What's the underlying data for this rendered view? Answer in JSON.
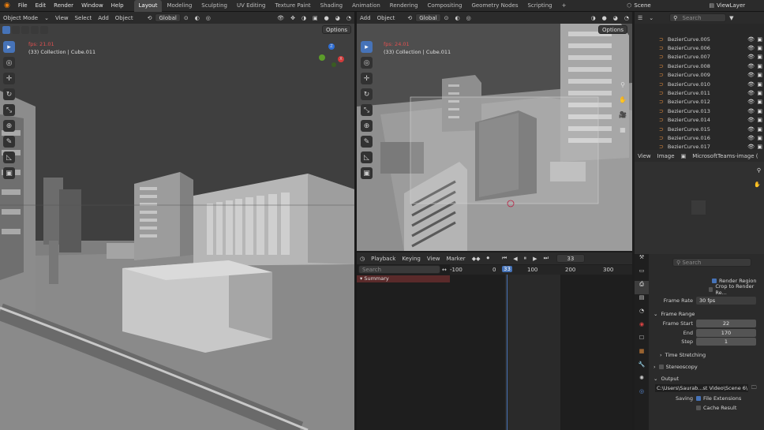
{
  "topbar": {
    "menus": [
      "File",
      "Edit",
      "Render",
      "Window",
      "Help"
    ],
    "workspaces": [
      "Layout",
      "Modeling",
      "Sculpting",
      "UV Editing",
      "Texture Paint",
      "Shading",
      "Animation",
      "Rendering",
      "Compositing",
      "Geometry Nodes",
      "Scripting"
    ],
    "active_workspace": "Layout",
    "add_tab": "+",
    "scene": "Scene",
    "view_layer": "ViewLayer"
  },
  "viewport_left": {
    "mode": "Object Mode",
    "menus": [
      "View",
      "Select",
      "Add",
      "Object"
    ],
    "orientation": "Global",
    "options": "Options",
    "fps": "fps: 21.01",
    "info": "(33) Collection | Cube.011"
  },
  "viewport_right": {
    "menus": [
      "Add",
      "Object"
    ],
    "orientation": "Global",
    "options": "Options",
    "fps": "fps: 24.01",
    "info": "(33) Collection | Cube.011"
  },
  "outliner": {
    "search_placeholder": "Search",
    "items": [
      "BezierCurve.005",
      "BezierCurve.006",
      "BezierCurve.007",
      "BezierCurve.008",
      "BezierCurve.009",
      "BezierCurve.010",
      "BezierCurve.011",
      "BezierCurve.012",
      "BezierCurve.013",
      "BezierCurve.014",
      "BezierCurve.015",
      "BezierCurve.016",
      "BezierCurve.017",
      "BezierCurve.018"
    ]
  },
  "image_editor": {
    "menus": [
      "View",
      "Image"
    ],
    "image_name": "MicrosoftTeams-image (c"
  },
  "timeline": {
    "menus": [
      "Playback",
      "Keying",
      "View",
      "Marker"
    ],
    "current_frame": "33",
    "search_placeholder": "Search",
    "summary": "Summary",
    "ruler": [
      "-100",
      "0",
      "100",
      "200",
      "300"
    ],
    "frame_marker": "33"
  },
  "properties": {
    "search_placeholder": "Search",
    "render_region": "Render Region",
    "crop_region": "Crop to Render Re...",
    "frame_rate_label": "Frame Rate",
    "frame_rate_value": "30 fps",
    "frame_range_title": "Frame Range",
    "frame_start_label": "Frame Start",
    "frame_start_value": "22",
    "end_label": "End",
    "end_value": "170",
    "step_label": "Step",
    "step_value": "1",
    "time_stretching": "Time Stretching",
    "stereoscopy": "Stereoscopy",
    "output_title": "Output",
    "output_path": "C:\\Users\\Saurab...st Video\\Scene 6\\",
    "saving_label": "Saving",
    "file_extensions": "File Extensions",
    "cache_result": "Cache Result"
  }
}
